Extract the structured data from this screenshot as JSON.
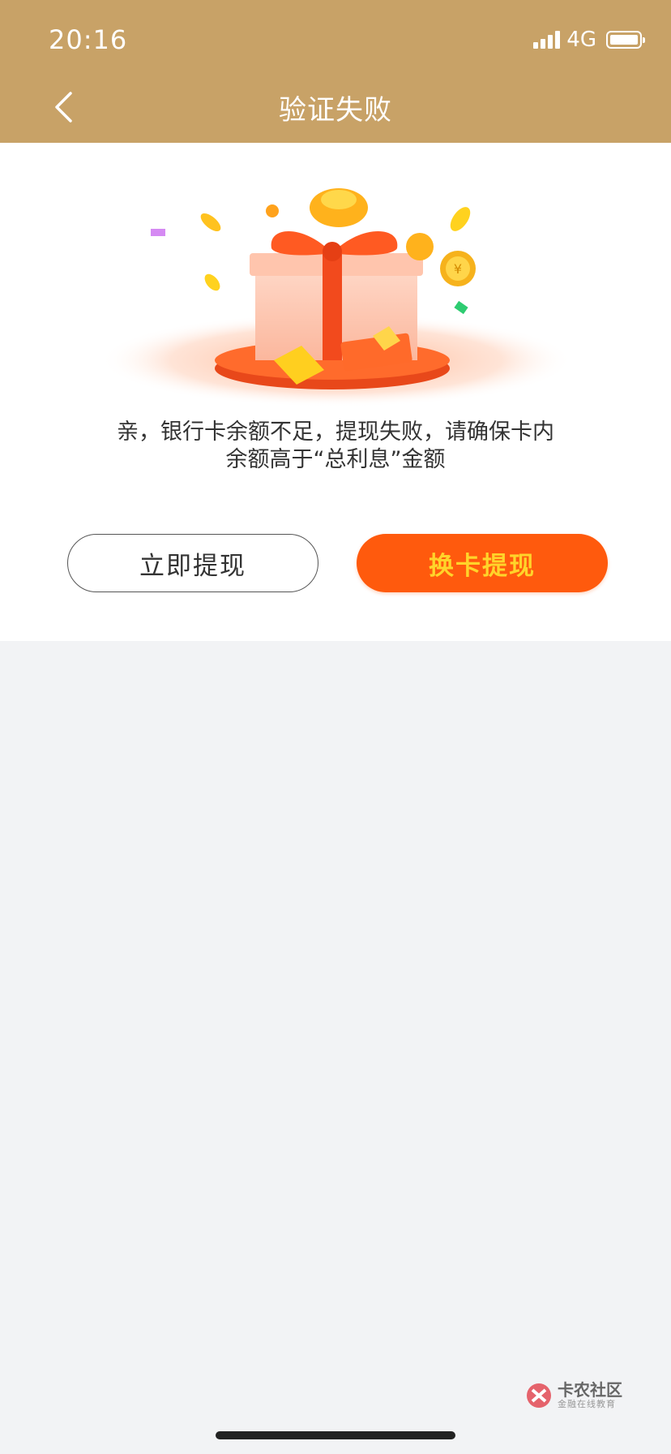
{
  "status_bar": {
    "time": "20:16",
    "network": "4G",
    "battery_level": 0.85
  },
  "nav": {
    "title": "验证失败",
    "back_icon": "chevron-left-icon"
  },
  "main": {
    "illustration": "gift-box-with-coins-illustration",
    "message_line1": "亲，银行卡余额不足，提现失败，请确保卡内",
    "message_line2": "余额高于“总利息”金额",
    "buttons": {
      "withdraw_now": "立即提现",
      "change_card": "换卡提现"
    }
  },
  "watermark": {
    "title": "卡农社区",
    "subtitle": "金融在线教育"
  },
  "colors": {
    "header": "#c8a267",
    "primary_button": "#ff5a0d",
    "primary_button_text": "#ffd42a",
    "background": "#f2f3f5"
  }
}
